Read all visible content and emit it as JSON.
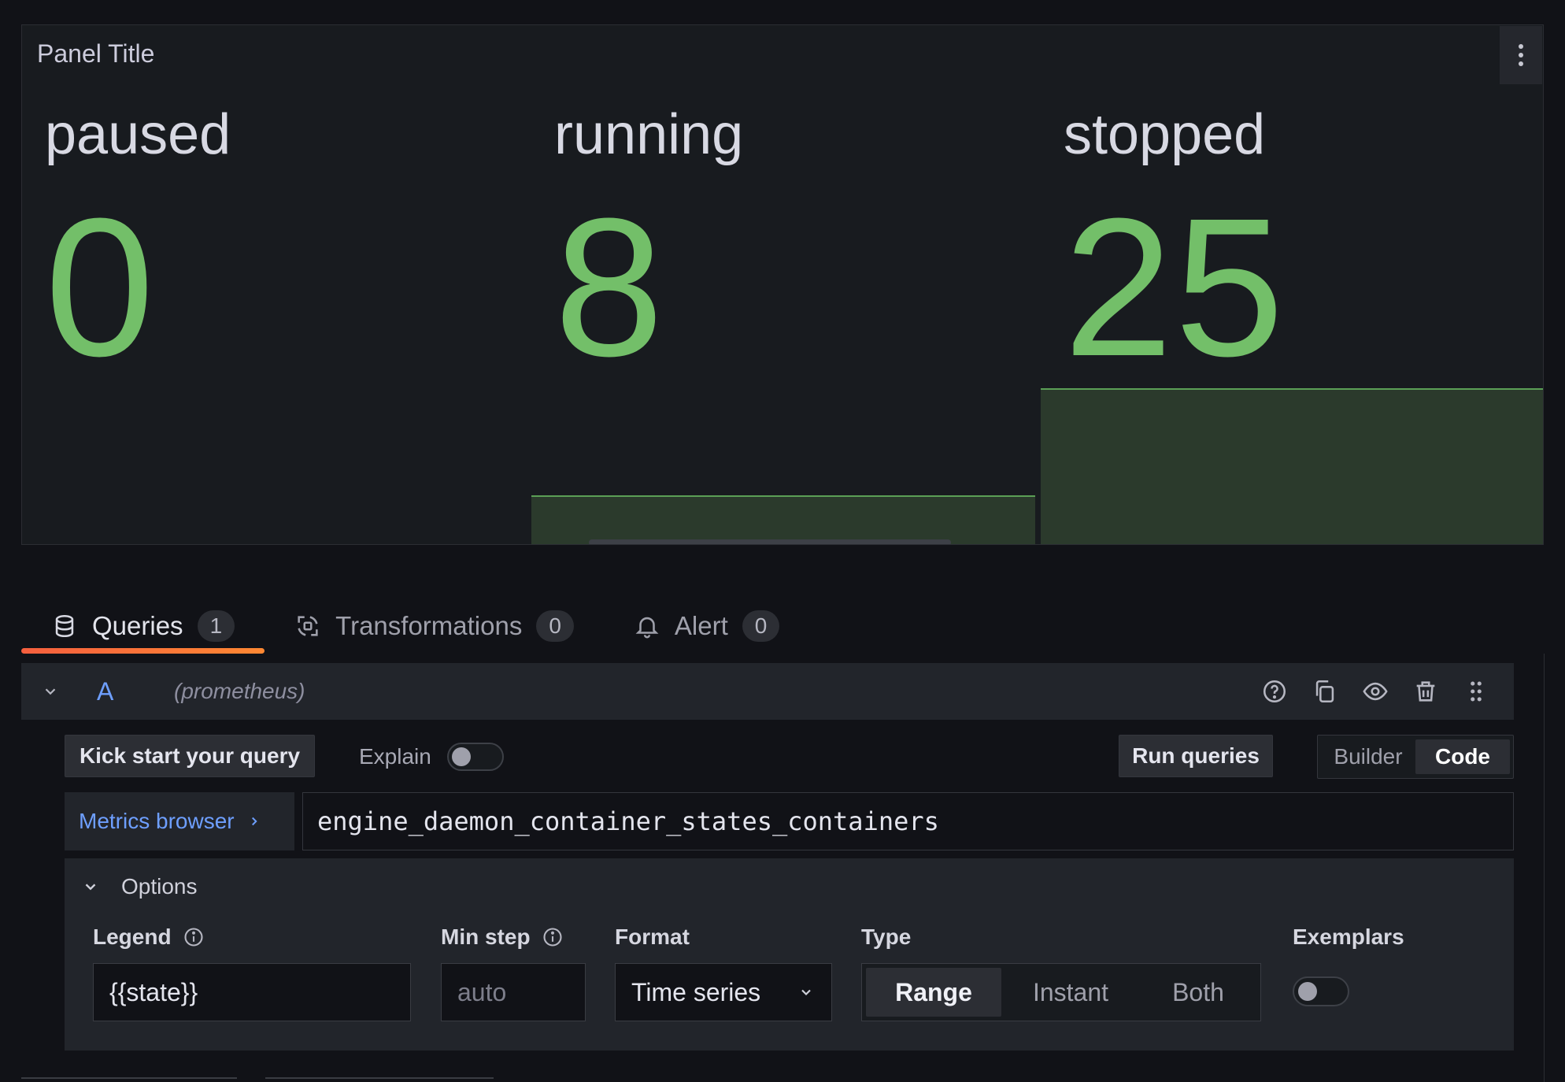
{
  "panel": {
    "title": "Panel Title",
    "stats": [
      {
        "name": "paused",
        "value": "0",
        "level": 0.0
      },
      {
        "name": "running",
        "value": "8",
        "level": 0.32
      },
      {
        "name": "stopped",
        "value": "25",
        "level": 1.0
      }
    ]
  },
  "tabs": [
    {
      "label": "Queries",
      "count": "1",
      "icon": "database-icon",
      "active": true
    },
    {
      "label": "Transformations",
      "count": "0",
      "icon": "transform-icon",
      "active": false
    },
    {
      "label": "Alert",
      "count": "0",
      "icon": "bell-icon",
      "active": false
    }
  ],
  "query": {
    "letter": "A",
    "datasource": "(prometheus)",
    "kick_start_label": "Kick start your query",
    "explain_label": "Explain",
    "run_queries_label": "Run queries",
    "mode_builder": "Builder",
    "mode_code": "Code",
    "metrics_browser_label": "Metrics browser",
    "expression": "engine_daemon_container_states_containers"
  },
  "options": {
    "title": "Options",
    "legend_label": "Legend",
    "legend_value": "{{state}}",
    "min_step_label": "Min step",
    "min_step_placeholder": "auto",
    "format_label": "Format",
    "format_value": "Time series",
    "type_label": "Type",
    "type_options": [
      "Range",
      "Instant",
      "Both"
    ],
    "type_selected": "Range",
    "exemplars_label": "Exemplars"
  },
  "colors": {
    "stat_green": "#73bf69",
    "tab_accent": "#ff7a3d",
    "link_blue": "#6e9fff"
  }
}
